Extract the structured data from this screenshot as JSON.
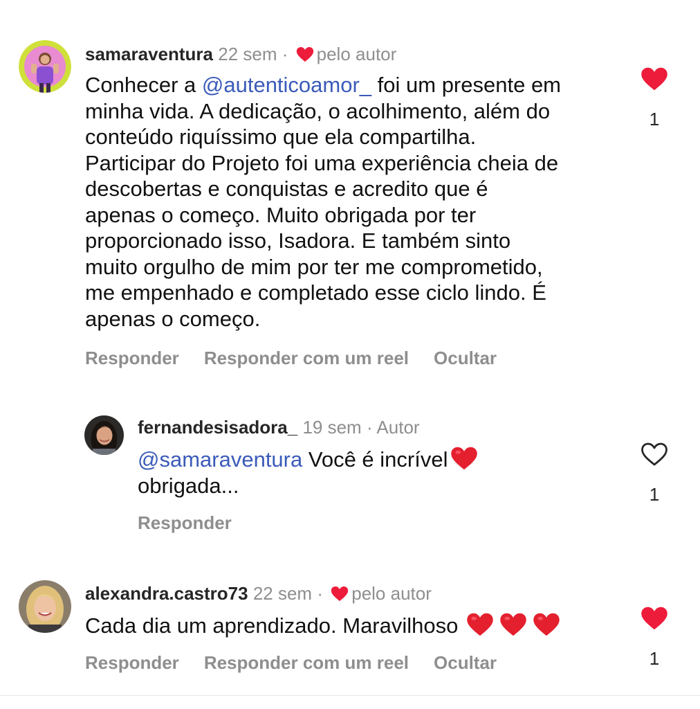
{
  "comments": [
    {
      "username": "samaraventura",
      "time": "22 sem",
      "separator": "·",
      "badge": "pelo autor",
      "badge_icon": "heart-filled-icon",
      "mention": "@autenticoamor_",
      "text_rest": " foi um presente em\nminha vida. A dedicação, o acolhimento, além do\nconteúdo riquíssimo que ela compartilha.\nParticipar do Projeto foi uma experiência cheia de\ndescobertas e conquistas e acredito que é\napenas o começo. Muito obrigada por ter\nproporcionado isso, Isadora. E também sinto\nmuito orgulho de mim por ter me comprometido,\nme empenhado e completado esse ciclo lindo. É\napenas o começo.",
      "text_prefix": "Conhecer a ",
      "actions": [
        "Responder",
        "Responder com um reel",
        "Ocultar"
      ],
      "liked": true,
      "like_count": "1"
    },
    {
      "username": "fernandesisadora_",
      "time": "19 sem",
      "separator": "·",
      "badge": "Autor",
      "mention": "@samaraventura",
      "text_prefix": "",
      "text_rest": " Você é  incrível",
      "text_line2": "obrigada...",
      "actions": [
        "Responder"
      ],
      "liked": false,
      "like_count": "1"
    },
    {
      "username": "alexandra.castro73",
      "time": "22 sem",
      "separator": "·",
      "badge": "pelo autor",
      "badge_icon": "heart-filled-icon",
      "text": "Cada dia um aprendizado. Maravilhoso",
      "actions": [
        "Responder",
        "Responder com um reel",
        "Ocultar"
      ],
      "liked": true,
      "like_count": "1"
    }
  ],
  "colors": {
    "heart": "#ed1c3a",
    "mention": "#3b5bb9",
    "meta": "#8e8e8e"
  }
}
